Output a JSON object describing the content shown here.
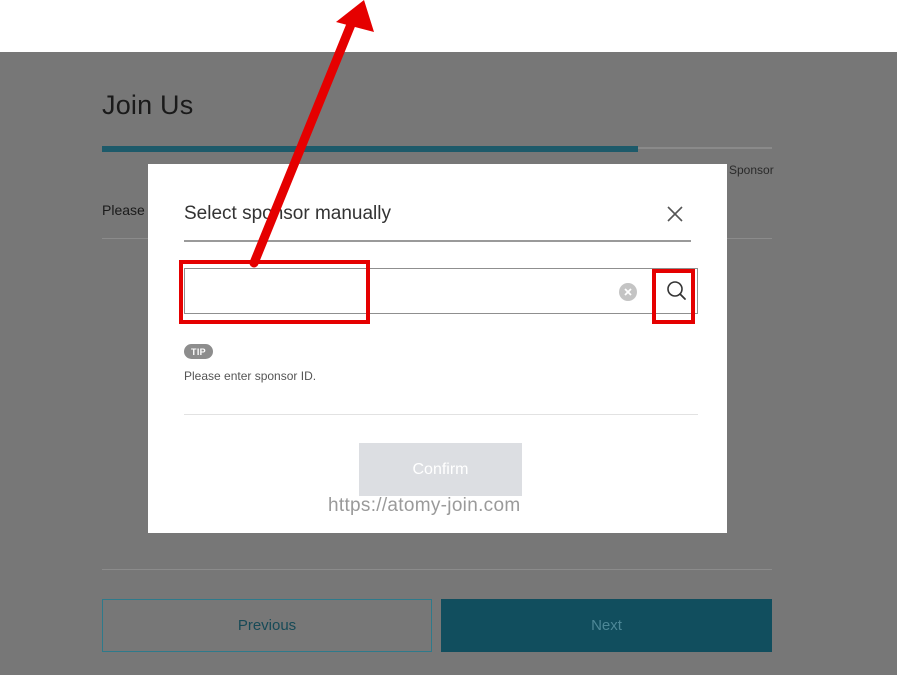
{
  "page": {
    "title": "Join Us",
    "step_label": "Sponsor",
    "intro_text": "Please s",
    "progress_fraction": 0.8,
    "previous_label": "Previous",
    "next_label": "Next"
  },
  "modal": {
    "title": "Select sponsor manually",
    "input_value": "",
    "tip_badge": "TIP",
    "tip_text": "Please enter sponsor ID.",
    "confirm_label": "Confirm"
  },
  "watermark": "https://atomy-join.com",
  "icons": {
    "close": "close-icon",
    "clear": "clear-icon",
    "search": "search-icon"
  },
  "colors": {
    "annotation": "#e50000",
    "accent": "#114e5e",
    "overlay": "#777777"
  }
}
